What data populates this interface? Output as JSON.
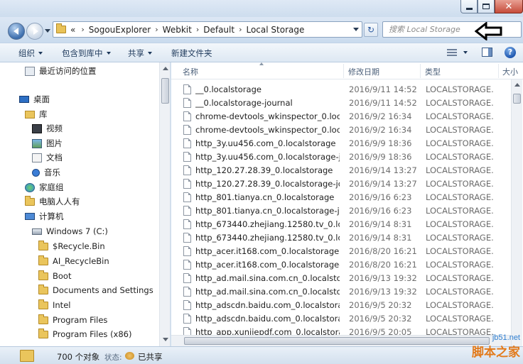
{
  "window": {
    "minimize_icon": "minimize-icon",
    "maximize_icon": "maximize-icon",
    "close_icon": "close-icon",
    "close_glyph": "✕"
  },
  "address_bar": {
    "overflow": "«",
    "crumbs": [
      "SogouExplorer",
      "Webkit",
      "Default",
      "Local Storage"
    ],
    "search_placeholder": "搜索 Local Storage",
    "refresh_glyph": "↻"
  },
  "toolbar": {
    "organize": "组织",
    "include_in_library": "包含到库中",
    "share": "共享",
    "new_folder": "新建文件夹",
    "help_glyph": "?"
  },
  "nav_tree": [
    {
      "label": "最近访问的位置",
      "icon": "recent-places-icon"
    },
    {
      "label": "桌面",
      "icon": "desktop-icon"
    },
    {
      "label": "库",
      "icon": "library-icon"
    },
    {
      "label": "视频",
      "icon": "video-icon"
    },
    {
      "label": "图片",
      "icon": "picture-icon"
    },
    {
      "label": "文档",
      "icon": "document-icon"
    },
    {
      "label": "音乐",
      "icon": "music-icon"
    },
    {
      "label": "家庭组",
      "icon": "homegroup-icon"
    },
    {
      "label": "电脑人人有",
      "icon": "folder-icon"
    },
    {
      "label": "计算机",
      "icon": "computer-icon"
    },
    {
      "label": "Windows 7  (C:)",
      "icon": "drive-icon"
    },
    {
      "label": "$Recycle.Bin",
      "icon": "folder-icon"
    },
    {
      "label": "AI_RecycleBin",
      "icon": "folder-icon"
    },
    {
      "label": "Boot",
      "icon": "folder-icon"
    },
    {
      "label": "Documents and Settings",
      "icon": "folder-icon"
    },
    {
      "label": "Intel",
      "icon": "folder-icon"
    },
    {
      "label": "Program Files",
      "icon": "folder-icon"
    },
    {
      "label": "Program Files (x86)",
      "icon": "folder-icon"
    }
  ],
  "columns": {
    "name": "名称",
    "modified": "修改日期",
    "type": "类型",
    "size": "大小"
  },
  "files": [
    {
      "name": "__0.localstorage",
      "date": "2016/9/11 14:52",
      "type": "LOCALSTORAGE..."
    },
    {
      "name": "__0.localstorage-journal",
      "date": "2016/9/11 14:52",
      "type": "LOCALSTORAGE..."
    },
    {
      "name": "chrome-devtools_wkinspector_0.local...",
      "date": "2016/9/2 16:34",
      "type": "LOCALSTORAGE..."
    },
    {
      "name": "chrome-devtools_wkinspector_0.local...",
      "date": "2016/9/2 16:34",
      "type": "LOCALSTORAGE..."
    },
    {
      "name": "http_3y.uu456.com_0.localstorage",
      "date": "2016/9/9 18:36",
      "type": "LOCALSTORAGE..."
    },
    {
      "name": "http_3y.uu456.com_0.localstorage-jou...",
      "date": "2016/9/9 18:36",
      "type": "LOCALSTORAGE..."
    },
    {
      "name": "http_120.27.28.39_0.localstorage",
      "date": "2016/9/14 13:27",
      "type": "LOCALSTORAGE..."
    },
    {
      "name": "http_120.27.28.39_0.localstorage-jour...",
      "date": "2016/9/14 13:27",
      "type": "LOCALSTORAGE..."
    },
    {
      "name": "http_801.tianya.cn_0.localstorage",
      "date": "2016/9/16 6:23",
      "type": "LOCALSTORAGE..."
    },
    {
      "name": "http_801.tianya.cn_0.localstorage-jour...",
      "date": "2016/9/16 6:23",
      "type": "LOCALSTORAGE..."
    },
    {
      "name": "http_673440.zhejiang.12580.tv_0.local...",
      "date": "2016/9/14 8:31",
      "type": "LOCALSTORAGE..."
    },
    {
      "name": "http_673440.zhejiang.12580.tv_0.local...",
      "date": "2016/9/14 8:31",
      "type": "LOCALSTORAGE..."
    },
    {
      "name": "http_acer.it168.com_0.localstorage",
      "date": "2016/8/20 16:21",
      "type": "LOCALSTORAGE..."
    },
    {
      "name": "http_acer.it168.com_0.localstorage-jo...",
      "date": "2016/8/20 16:21",
      "type": "LOCALSTORAGE..."
    },
    {
      "name": "http_ad.mail.sina.com.cn_0.localstorage",
      "date": "2016/9/13 19:32",
      "type": "LOCALSTORAGE..."
    },
    {
      "name": "http_ad.mail.sina.com.cn_0.localstora...",
      "date": "2016/9/13 19:32",
      "type": "LOCALSTORAGE..."
    },
    {
      "name": "http_adscdn.baidu.com_0.localstorage",
      "date": "2016/9/5 20:32",
      "type": "LOCALSTORAGE..."
    },
    {
      "name": "http_adscdn.baidu.com_0.localstorag...",
      "date": "2016/9/5 20:32",
      "type": "LOCALSTORAGE..."
    },
    {
      "name": "http_app.xunjiepdf.com_0.localstorage",
      "date": "2016/9/5 20:05",
      "type": "LOCALSTORAGE..."
    }
  ],
  "status": {
    "count": "700 个对象",
    "state_label": "状态:",
    "state_value": "已共享"
  },
  "watermark": {
    "url": "jb51.net",
    "name": "脚本之家"
  }
}
